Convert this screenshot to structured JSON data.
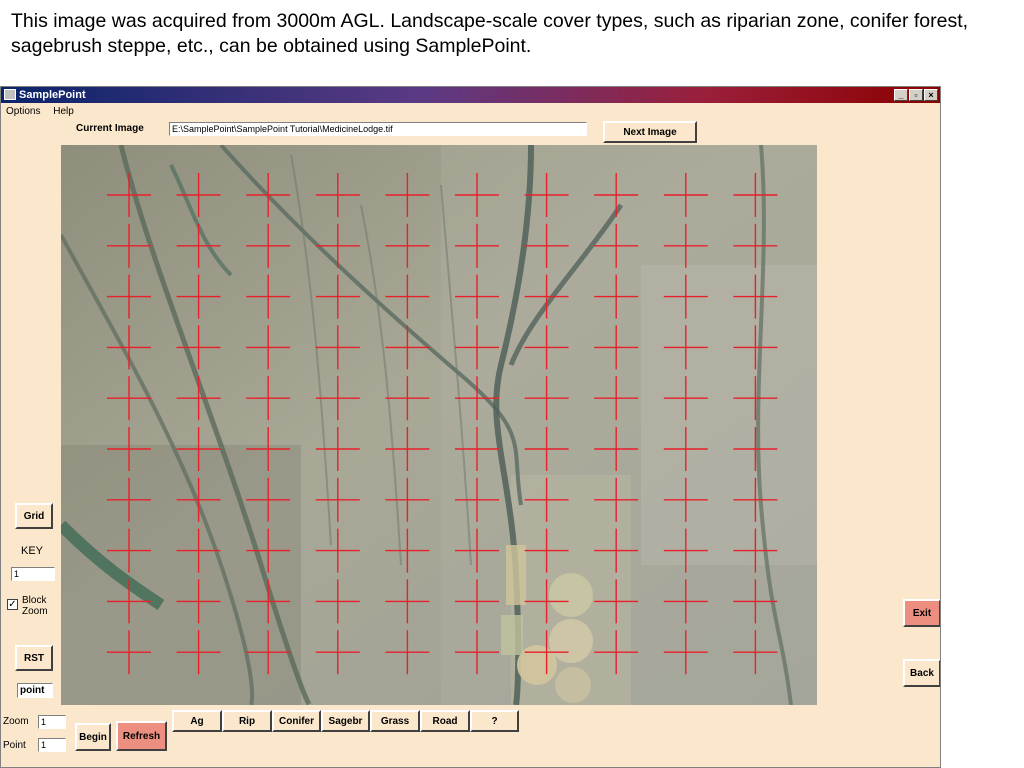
{
  "caption": "This image was acquired from 3000m AGL. Landscape-scale cover types, such as riparian zone, conifer forest,  sagebrush steppe, etc., can be obtained using SamplePoint.",
  "window": {
    "title": "SamplePoint",
    "controls": {
      "minimize": "_",
      "restore": "▫",
      "close": "×"
    }
  },
  "menu": [
    "Options",
    "Help"
  ],
  "current_image": {
    "label": "Current Image",
    "path": "E:\\SamplePoint\\SamplePoint  Tutorial\\MedicineLodge.tif"
  },
  "next_image_label": "Next Image",
  "left_panel": {
    "grid_label": "Grid",
    "key_label": "KEY",
    "key_value": "1",
    "block_zoom_label": "Block Zoom",
    "block_zoom_checked": true,
    "rst_label": "RST",
    "mode_value": "point"
  },
  "bottom": {
    "zoom_label": "Zoom",
    "zoom_value": "1",
    "point_label": "Point",
    "point_value": "1",
    "begin_label": "Begin",
    "refresh_label": "Refresh",
    "categories": [
      "Ag",
      "Rip",
      "Conifer",
      "Sagebr",
      "Grass",
      "Road",
      "?"
    ]
  },
  "right_panel": {
    "exit_label": "Exit",
    "back_label": "Back"
  },
  "grid": {
    "rows": 10,
    "cols": 10,
    "crosshair_color": "#e8202a"
  },
  "colors": {
    "window_bg": "#fbe8cc",
    "title_start": "#0a246a",
    "title_end": "#8b0000",
    "red_button": "#ec8f80"
  }
}
